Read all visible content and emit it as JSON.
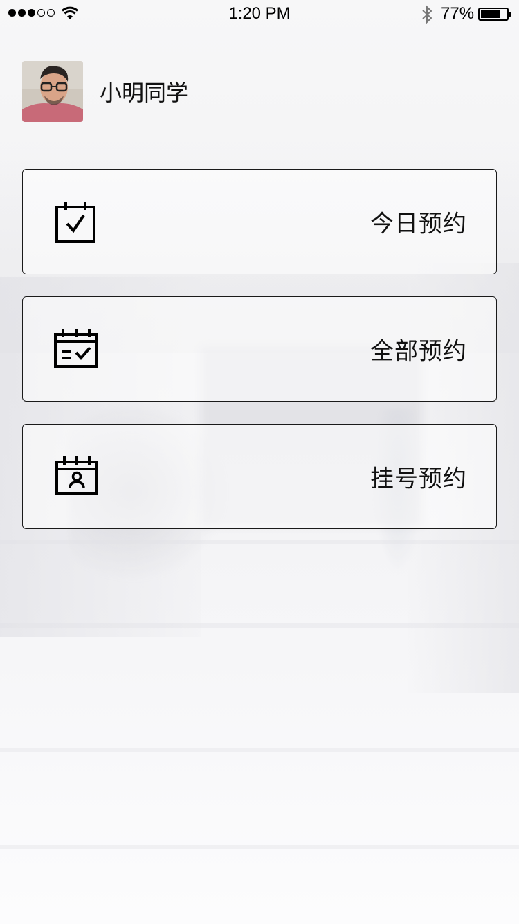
{
  "status_bar": {
    "time": "1:20 PM",
    "battery_percent_text": "77%",
    "battery_level": 0.77,
    "signal_bars_filled": 3,
    "signal_bars_total": 5
  },
  "profile": {
    "name": "小明同学"
  },
  "menu": [
    {
      "label": "今日预约",
      "icon": "calendar-check-icon"
    },
    {
      "label": "全部预约",
      "icon": "calendar-list-check-icon"
    },
    {
      "label": "挂号预约",
      "icon": "calendar-person-icon"
    }
  ]
}
